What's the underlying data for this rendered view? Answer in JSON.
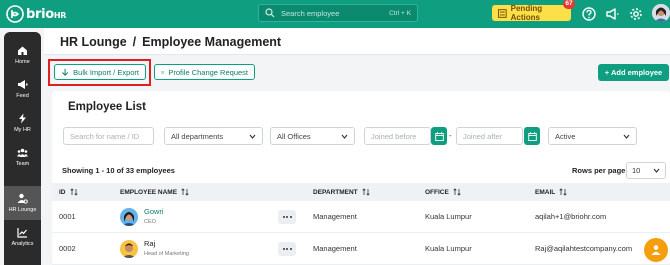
{
  "brand": {
    "name": "brio",
    "suffix": "HR"
  },
  "topbar": {
    "search_placeholder": "Search employee",
    "search_shortcut": "Ctrl + K",
    "pending_label": "Pending Actions",
    "pending_count": "67"
  },
  "sidebar": {
    "items": [
      {
        "label": "Home",
        "icon": "home-icon"
      },
      {
        "label": "Feed",
        "icon": "megaphone-icon"
      },
      {
        "label": "My HR",
        "icon": "bolt-icon"
      },
      {
        "label": "Team",
        "icon": "team-icon"
      },
      {
        "label": "HR Lounge",
        "icon": "user-gear-icon",
        "active": true
      },
      {
        "label": "Analytics",
        "icon": "chart-icon"
      }
    ]
  },
  "header": {
    "crumb1": "HR Lounge",
    "separator": "/",
    "crumb2": "Employee Management"
  },
  "actions": {
    "bulk": "Bulk Import / Export",
    "profile_change": "Profile Change Request",
    "add": "+ Add employee"
  },
  "list": {
    "title": "Employee List",
    "filters": {
      "name_placeholder": "Search for name / ID",
      "department": "All departments",
      "office": "All Offices",
      "joined_before": "Joined before",
      "joined_after": "Joined after",
      "status": "Active",
      "range_separator": "-"
    },
    "showing": "Showing 1 - 10 of 33 employees",
    "rows_per_page_label": "Rows per page",
    "rows_per_page": "10",
    "columns": {
      "id": "ID",
      "name": "EMPLOYEE NAME",
      "department": "DEPARTMENT",
      "office": "OFFICE",
      "email": "EMAIL"
    },
    "rows": [
      {
        "id": "0001",
        "name": "Gowri",
        "title": "CEO",
        "department": "Management",
        "office": "Kuala Lumpur",
        "email": "aqilah+1@briohr.com"
      },
      {
        "id": "0002",
        "name": "Raj",
        "title": "Head of Marketing",
        "department": "Management",
        "office": "Kuala Lumpur",
        "email": "Raj@aqilahtestcompany.com"
      }
    ]
  },
  "colors": {
    "brand_green": "#0f9f80",
    "pending_yellow": "#fde047",
    "highlight_red": "#e02020",
    "sidebar_dark": "#2b2b2b"
  }
}
